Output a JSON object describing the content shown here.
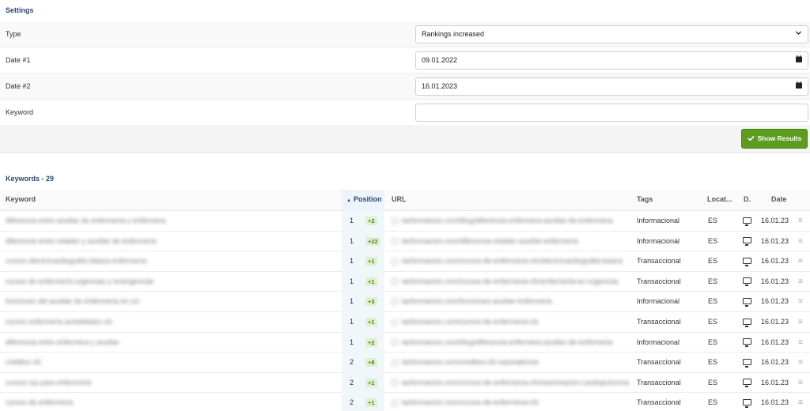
{
  "settings": {
    "title": "Settings",
    "type_label": "Type",
    "type_value": "Rankings increased",
    "date1_label": "Date #1",
    "date1_value": "09.01.2022",
    "date2_label": "Date #2",
    "date2_value": "16.01.2023",
    "keyword_label": "Keyword",
    "keyword_value": "",
    "show_results_label": "Show Results"
  },
  "keywords": {
    "title": "Keywords - 29",
    "columns": {
      "keyword": "Keyword",
      "position": "Position",
      "url": "URL",
      "tags": "Tags",
      "location": "Locat...",
      "device": "D.",
      "date": "Date"
    },
    "rows": [
      {
        "keyword": "diferencia entre auxiliar de enfermería y enfermera",
        "position": "1",
        "change": "+2",
        "url": "tacformacion.com/blog/diferencia-enfermera-auxiliar-de-enfermeria",
        "tag": "Informacional",
        "location": "ES",
        "date": "16.01.23"
      },
      {
        "keyword": "diferencia entre celador y auxiliar de enfermería",
        "position": "1",
        "change": "+22",
        "url": "tacformacion.com/diferencia-celador-auxiliar-enfermeria",
        "tag": "Informacional",
        "location": "ES",
        "date": "16.01.23"
      },
      {
        "keyword": "cursos electrocardiografía básica enfermería",
        "position": "1",
        "change": "+1",
        "url": "tacformacion.com/cursos-de-enfermeria-cfc/electrocardiografia-basica",
        "tag": "Transaccional",
        "location": "ES",
        "date": "16.01.23"
      },
      {
        "keyword": "cursos de enfermería urgencias y emergencias",
        "position": "1",
        "change": "+1",
        "url": "tacformacion.com/cursos-de-enfermeria-cfc/enfermeria-en-urgencias",
        "tag": "Transaccional",
        "location": "ES",
        "date": "16.01.23"
      },
      {
        "keyword": "funciones del auxiliar de enfermería en uci",
        "position": "1",
        "change": "+3",
        "url": "tacformacion.com/funciones-auxiliar-enfermeria",
        "tag": "Informacional",
        "location": "ES",
        "date": "16.01.23"
      },
      {
        "keyword": "cursos enfermería acreditados cfc",
        "position": "1",
        "change": "+1",
        "url": "tacformacion.com/cursos-de-enfermeria-cfc",
        "tag": "Transaccional",
        "location": "ES",
        "date": "16.01.23"
      },
      {
        "keyword": "diferencia entre enfermera y auxiliar",
        "position": "1",
        "change": "+2",
        "url": "tacformacion.com/blog/diferencia-enfermera-auxiliar-de-enfermeria",
        "tag": "Informacional",
        "location": "ES",
        "date": "16.01.23"
      },
      {
        "keyword": "créditos cfc",
        "position": "2",
        "change": "+8",
        "url": "tacformacion.com/creditos-cfc-equivalencia",
        "tag": "Transaccional",
        "location": "ES",
        "date": "16.01.23"
      },
      {
        "keyword": "cursos rcp para enfermería",
        "position": "2",
        "change": "+1",
        "url": "tacformacion.com/cursos-de-enfermeria-cfc/reanimacion-cardiopulmonar",
        "tag": "Transaccional",
        "location": "ES",
        "date": "16.01.23"
      },
      {
        "keyword": "cursos de enfermería",
        "position": "2",
        "change": "+1",
        "url": "tacformacion.com/cursos-de-enfermeria-cfc",
        "tag": "Transaccional",
        "location": "ES",
        "date": "16.01.23"
      }
    ]
  }
}
